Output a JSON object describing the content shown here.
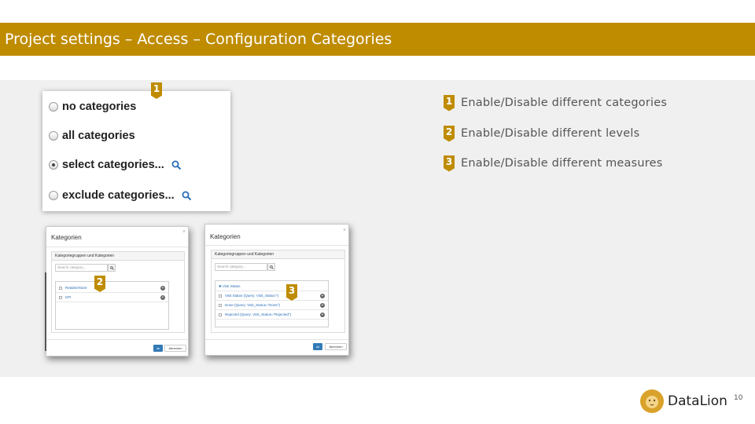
{
  "header": {
    "title": "Project settings – Access – Configuration Categories"
  },
  "markers": [
    "1",
    "2",
    "3"
  ],
  "radio_options": [
    {
      "label": "no categories",
      "checked": false,
      "has_search": false
    },
    {
      "label": "all categories",
      "checked": false,
      "has_search": false
    },
    {
      "label": "select categories...",
      "checked": true,
      "has_search": true
    },
    {
      "label": "exclude categories...",
      "checked": false,
      "has_search": true
    }
  ],
  "dialog_left": {
    "title": "Kategorien",
    "close": "×",
    "panel_heading": "Kategoriegruppen und Kategorien",
    "search_placeholder": "Search category...",
    "items": [
      "Retailer/Store",
      "KPI"
    ],
    "ok": "ok",
    "cancel": "Abrechen"
  },
  "dialog_right": {
    "title": "Kategorien",
    "close": "×",
    "panel_heading": "Kategoriegruppen und Kategorien",
    "search_placeholder": "Search category...",
    "group": "✚ Visit Status",
    "items": [
      "Visit Status (Query: Visit_Status:*)",
      "Done (Query: Visit_Status=\"Done\")",
      "Rejected (Query: Visit_Status=\"Rejected\")"
    ],
    "ok": "ok",
    "cancel": "Abrechen"
  },
  "legend": [
    {
      "num": "1",
      "text": "Enable/Disable different categories"
    },
    {
      "num": "2",
      "text": "Enable/Disable different levels"
    },
    {
      "num": "3",
      "text": "Enable/Disable different measures"
    }
  ],
  "logo": {
    "name": "DataLion"
  },
  "page_number": "10",
  "colors": {
    "accent": "#bf8c00",
    "band": "#f0f0f0",
    "link": "#2a6db5",
    "primary_button": "#337ab7"
  },
  "icons": {
    "search": "magnifier-icon",
    "logo": "lion-logo-icon"
  }
}
